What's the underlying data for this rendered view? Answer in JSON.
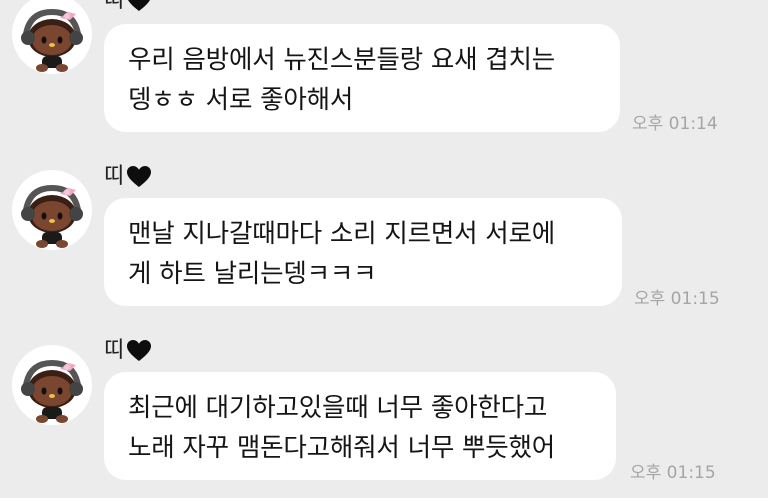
{
  "messages": [
    {
      "sender": "띠",
      "lines": [
        "우리 음방에서 뉴진스분들랑 요새 겹치는",
        "뎅ㅎㅎ 서로 좋아해서"
      ],
      "time": "오후 01:14"
    },
    {
      "sender": "띠",
      "lines": [
        "맨날 지나갈때마다 소리 지르면서 서로에",
        "게 하트 날리는뎅ㅋㅋㅋ"
      ],
      "time": "오후 01:15"
    },
    {
      "sender": "띠",
      "lines": [
        "최근에 대기하고있을때 너무 좋아한다고",
        "노래 자꾸 맴돈다고해줘서 너무 뿌듯했어"
      ],
      "time": "오후 01:15"
    }
  ],
  "icons": {
    "heart": "black-heart-icon",
    "avatar": "kitty-character-avatar"
  },
  "colors": {
    "background": "#ececec",
    "bubble": "#ffffff",
    "time": "#a5a5a5"
  }
}
